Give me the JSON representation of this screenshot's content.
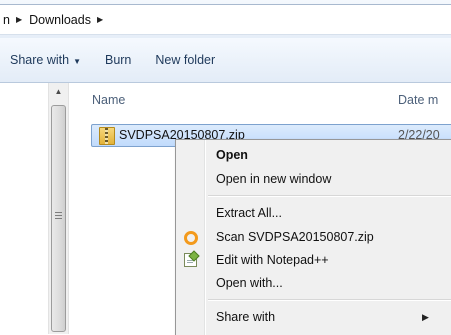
{
  "breadcrumb": {
    "partial_prev": "n",
    "folder": "Downloads"
  },
  "toolbar": {
    "share_with": "Share with",
    "burn": "Burn",
    "new_folder": "New folder"
  },
  "columns": {
    "name": "Name",
    "date": "Date m"
  },
  "file": {
    "name": "SVDPSA20150807.zip",
    "date": "2/22/20"
  },
  "context_menu": {
    "items": [
      {
        "label": "Open",
        "bold": true
      },
      {
        "label": "Open in new window"
      },
      {
        "label": "Extract All..."
      },
      {
        "label": "Scan SVDPSA20150807.zip",
        "icon": "scan-icon"
      },
      {
        "label": "Edit with Notepad++",
        "icon": "notepadpp-icon"
      },
      {
        "label": "Open with..."
      },
      {
        "label": "Share with",
        "submenu": true
      }
    ]
  },
  "colors": {
    "selection": "#c1dbfc",
    "toolbar_text": "#1e395b",
    "menu_bg": "#f0f0f0"
  }
}
